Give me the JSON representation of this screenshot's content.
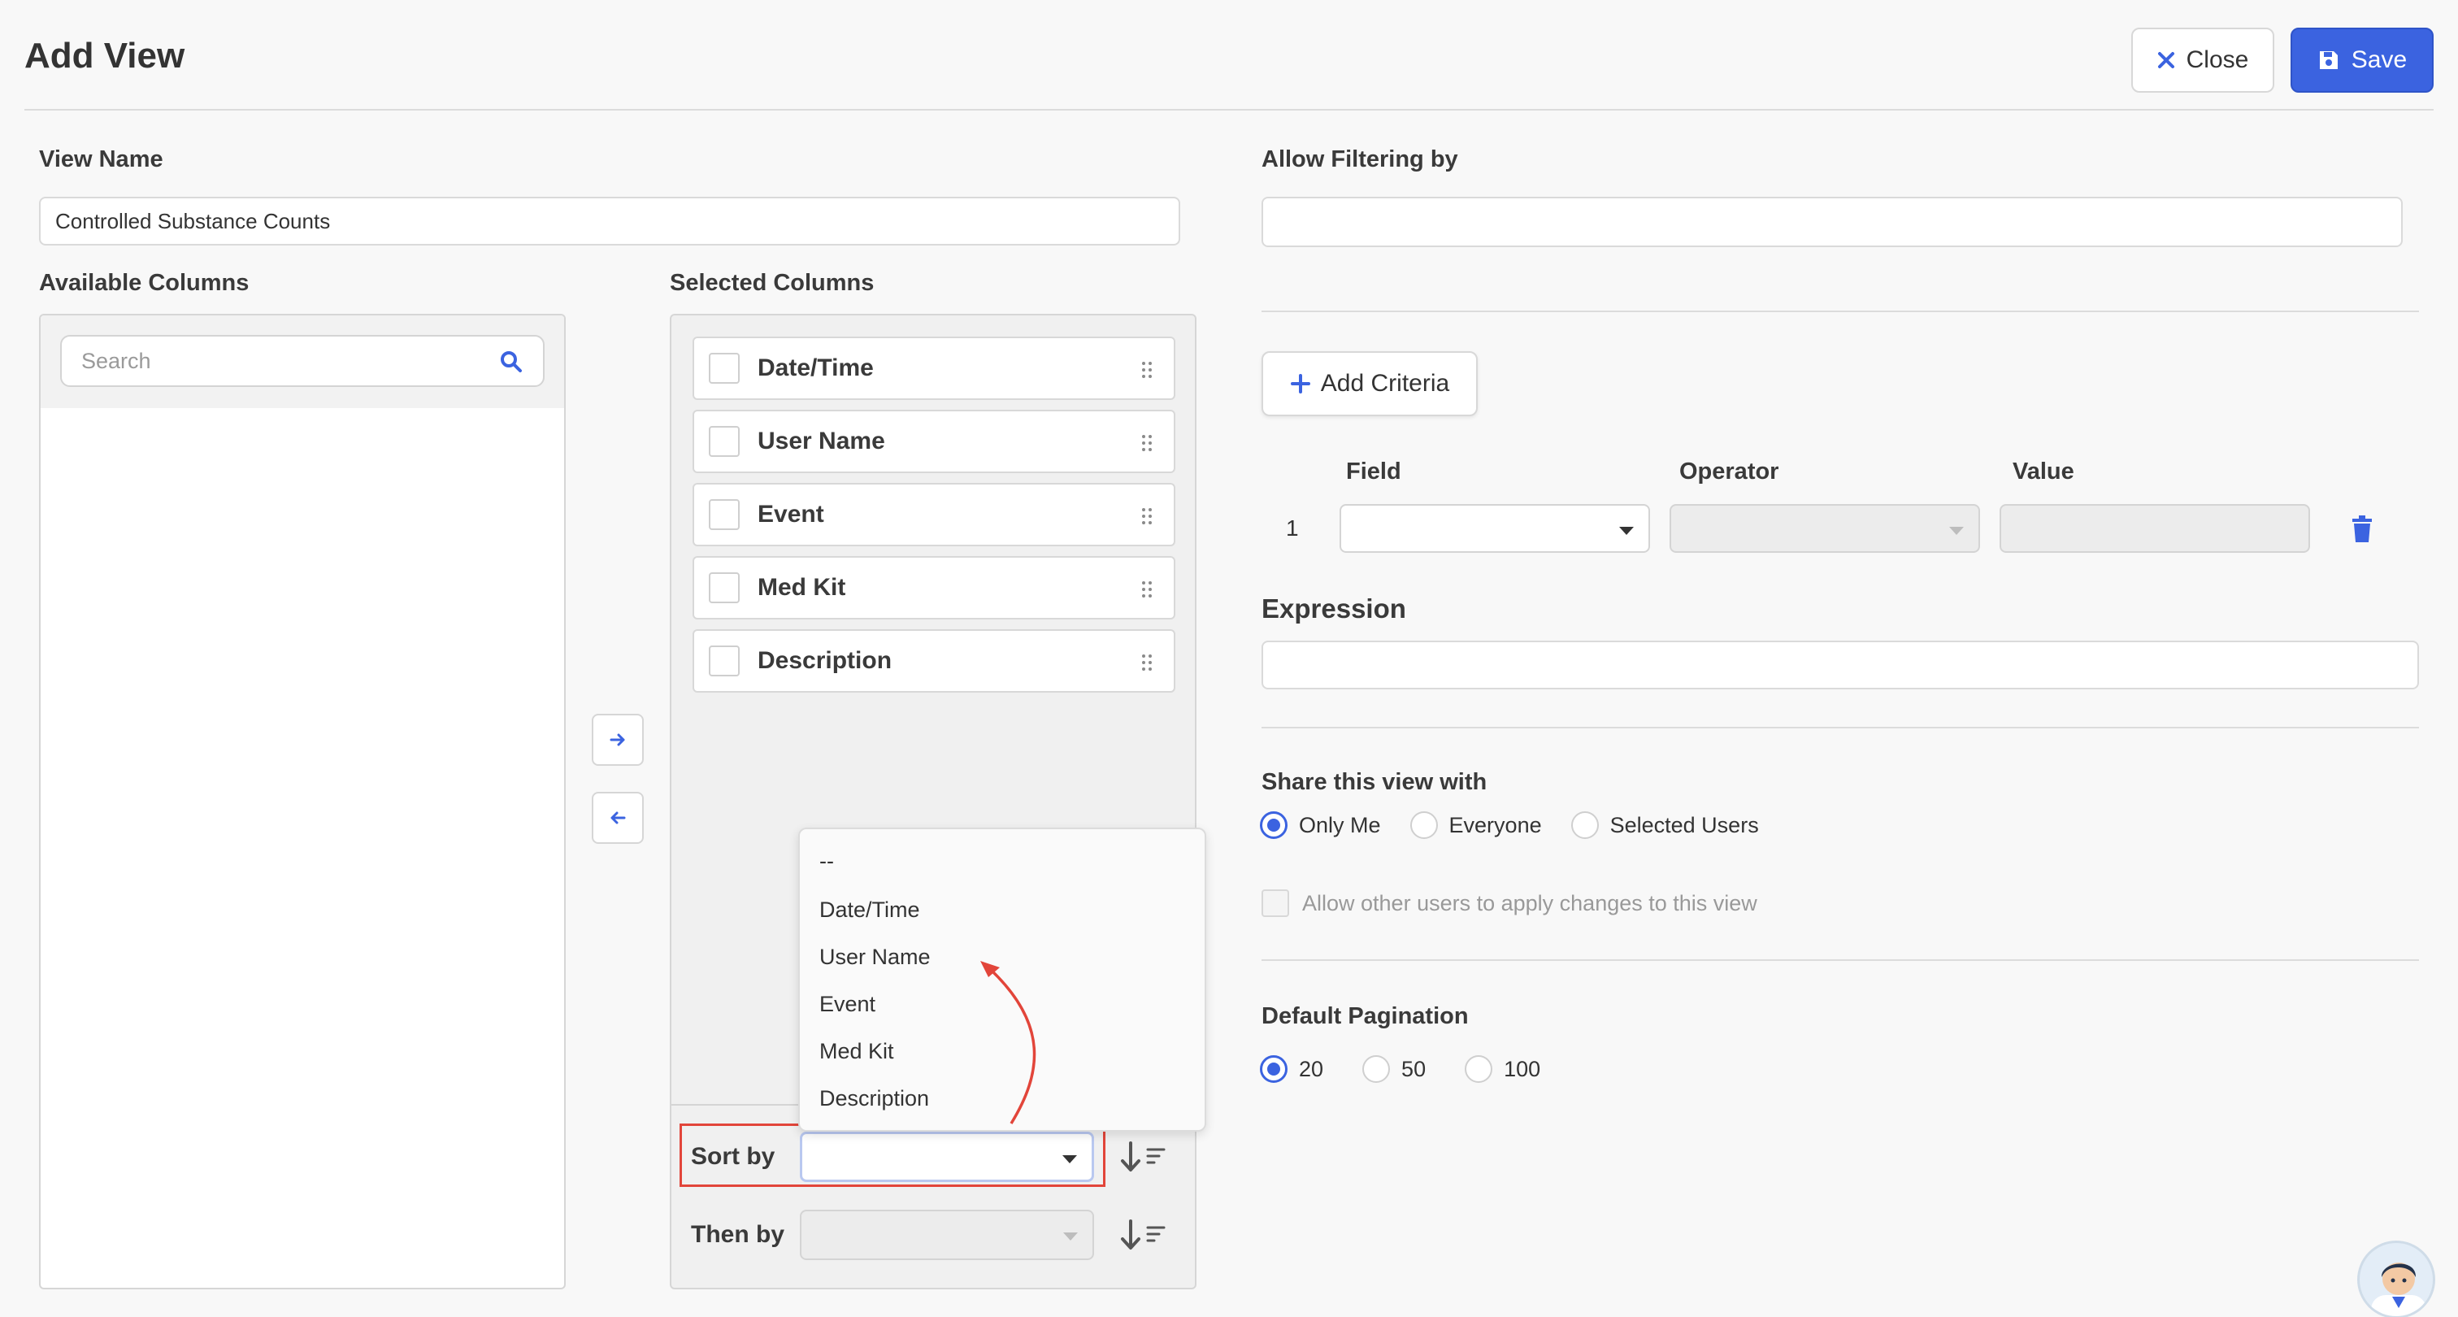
{
  "header": {
    "title": "Add View",
    "close_label": "Close",
    "save_label": "Save"
  },
  "view_name": {
    "label": "View Name",
    "value": "Controlled Substance Counts"
  },
  "available_columns": {
    "label": "Available Columns",
    "search_placeholder": "Search"
  },
  "selected_columns": {
    "label": "Selected Columns",
    "items": [
      "Date/Time",
      "User Name",
      "Event",
      "Med Kit",
      "Description"
    ]
  },
  "sort": {
    "sort_by_label": "Sort by",
    "then_by_label": "Then by",
    "sort_by_value": "",
    "options": [
      "--",
      "Date/Time",
      "User Name",
      "Event",
      "Med Kit",
      "Description"
    ]
  },
  "filtering": {
    "label": "Allow Filtering by",
    "value": ""
  },
  "criteria": {
    "add_label": "Add Criteria",
    "headers": {
      "field": "Field",
      "operator": "Operator",
      "value": "Value"
    },
    "rows": [
      {
        "index": "1",
        "field": "",
        "operator": "",
        "value": ""
      }
    ]
  },
  "expression": {
    "label": "Expression",
    "value": ""
  },
  "share": {
    "label": "Share this view with",
    "options": [
      "Only Me",
      "Everyone",
      "Selected Users"
    ],
    "selected": "Only Me",
    "allow_changes_label": "Allow other users to apply changes to this view",
    "allow_changes_checked": false
  },
  "pagination": {
    "label": "Default Pagination",
    "options": [
      "20",
      "50",
      "100"
    ],
    "selected": "20"
  },
  "colors": {
    "accent": "#3b63e0",
    "annotation": "#e2453a",
    "delete_icon": "#3b63e0"
  },
  "icons": [
    "close-icon",
    "save-icon",
    "search-icon",
    "arrow-right-icon",
    "arrow-left-icon",
    "drag-handle-icon",
    "sort-direction-icon",
    "plus-icon",
    "trash-icon",
    "caret-down-icon"
  ]
}
